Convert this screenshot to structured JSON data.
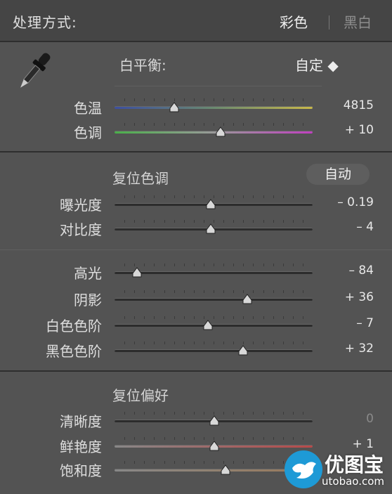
{
  "header": {
    "title": "处理方式:",
    "color_option": "彩色",
    "bw_option": "黑白"
  },
  "white_balance": {
    "label": "白平衡:",
    "value": "自定 ◆"
  },
  "wb_sliders": [
    {
      "id": "temp",
      "label": "色温",
      "value": "4815",
      "level": 0.3
    },
    {
      "id": "tint",
      "label": "色调",
      "value": "+ 10",
      "level": 0.535
    }
  ],
  "tone": {
    "label": "复位色调",
    "auto_label": "自动",
    "sliders": [
      {
        "id": "exposure",
        "label": "曝光度",
        "value": "– 0.19",
        "level": 0.485
      },
      {
        "id": "contrast",
        "label": "对比度",
        "value": "– 4",
        "level": 0.485
      }
    ]
  },
  "tone2_sliders": [
    {
      "id": "highlights",
      "label": "高光",
      "value": "– 84",
      "level": 0.115
    },
    {
      "id": "shadows",
      "label": "阴影",
      "value": "+ 36",
      "level": 0.67
    },
    {
      "id": "whites",
      "label": "白色色阶",
      "value": "– 7",
      "level": 0.47
    },
    {
      "id": "blacks",
      "label": "黑色色阶",
      "value": "+ 32",
      "level": 0.65
    }
  ],
  "presence": {
    "label": "复位偏好",
    "sliders": [
      {
        "id": "clarity",
        "label": "清晰度",
        "value": "0",
        "level": 0.505
      },
      {
        "id": "vibrance",
        "label": "鲜艳度",
        "value": "+ 1",
        "level": 0.505
      },
      {
        "id": "saturation",
        "label": "饱和度",
        "value": "",
        "level": 0.56
      }
    ]
  },
  "watermark": {
    "text": "优图宝",
    "url": "utobao.com"
  },
  "colors": {
    "panel": "#535353",
    "header": "#454545",
    "divider": "#2e2e2e",
    "temp_left": "#3c4fa0",
    "temp_right": "#c8b84a",
    "tint_left": "#4ab04a",
    "tint_right": "#c040c0"
  }
}
